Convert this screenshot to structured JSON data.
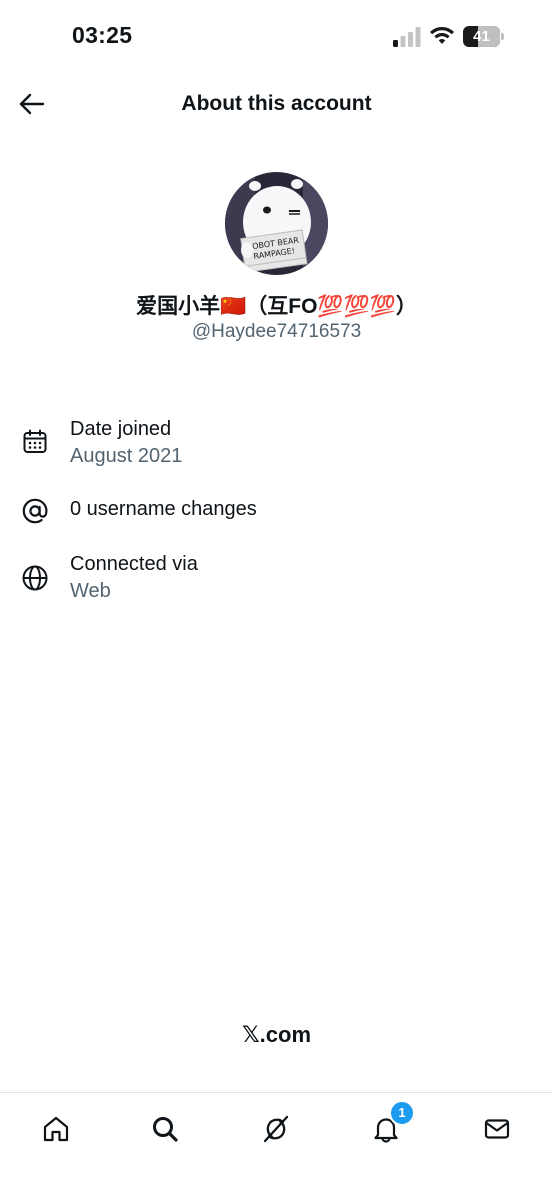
{
  "status_bar": {
    "time": "03:25",
    "battery_level": "41",
    "battery_fraction": 0.41
  },
  "header": {
    "back_icon": "arrow-left-icon",
    "title": "About this account"
  },
  "profile": {
    "avatar_caption": "ROBOT BEAR RAMPAGE!",
    "display_name": "爱国小羊🇨🇳（互FO💯💯💯）",
    "handle": "@Haydee74716573"
  },
  "info": {
    "date_joined": {
      "icon": "calendar-icon",
      "label": "Date joined",
      "value": "August 2021"
    },
    "username_changes": {
      "icon": "at-sign-icon",
      "label": "0 username changes"
    },
    "connected_via": {
      "icon": "globe-icon",
      "label": "Connected via",
      "value": "Web"
    }
  },
  "footer": {
    "site": "𝕏.com"
  },
  "tab_bar": {
    "tabs": [
      {
        "icon": "home-icon"
      },
      {
        "icon": "search-icon"
      },
      {
        "icon": "grok-icon"
      },
      {
        "icon": "bell-icon",
        "badge": "1"
      },
      {
        "icon": "mail-icon"
      }
    ]
  },
  "colors": {
    "text_primary": "#0f1419",
    "text_secondary": "#536471",
    "accent": "#1d9bf0"
  }
}
